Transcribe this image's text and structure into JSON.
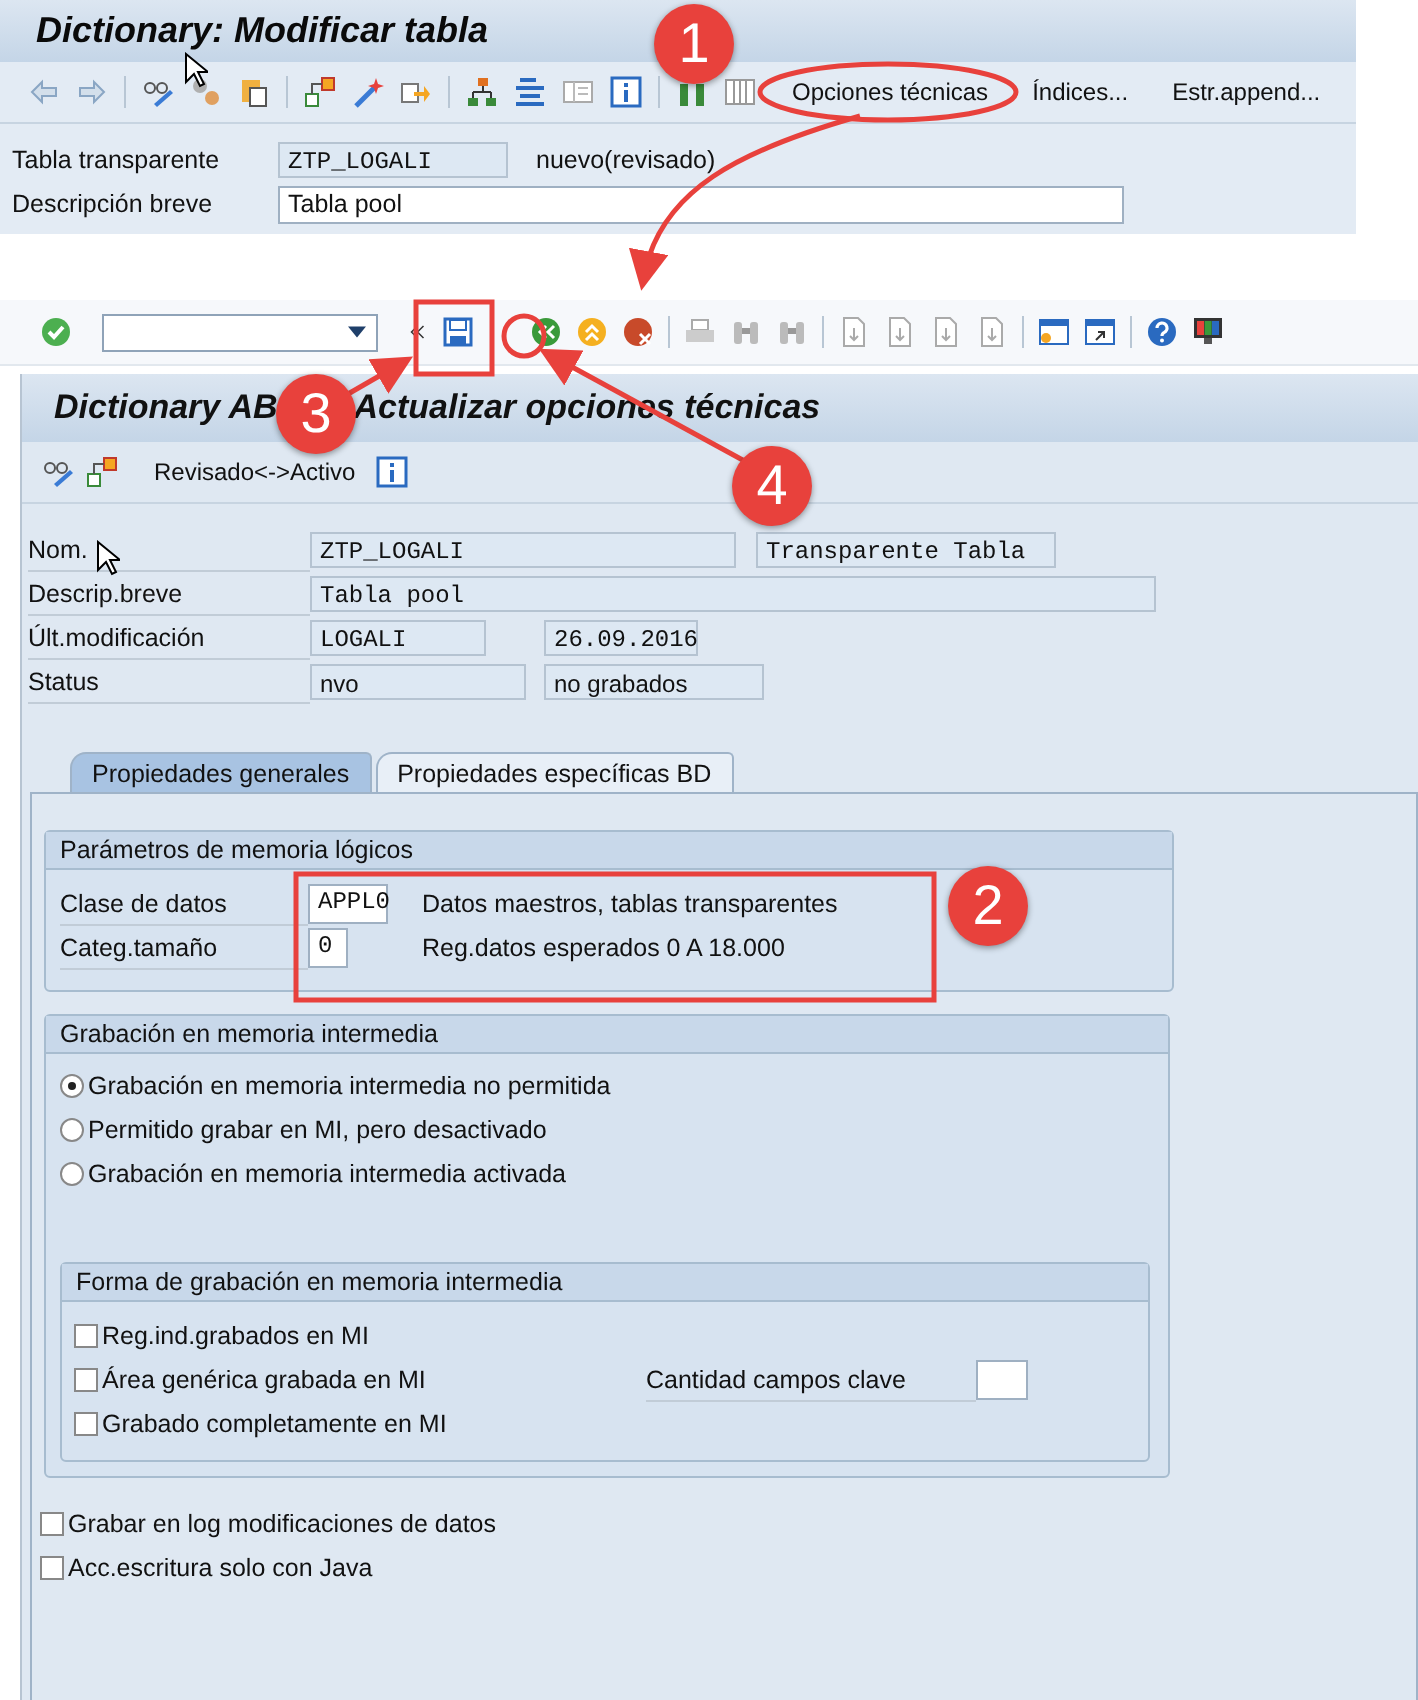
{
  "window": {
    "title": "Dictionary: Modificar tabla"
  },
  "toolbar": {
    "buttons": [
      {
        "label": "Opciones técnicas"
      },
      {
        "label": "Índices..."
      },
      {
        "label": "Estr.append..."
      }
    ]
  },
  "header_fields": [
    {
      "label": "Tabla transparente",
      "value": "ZTP_LOGALI",
      "note": "nuevo(revisado)"
    },
    {
      "label": "Descripción breve",
      "value": "Tabla pool"
    }
  ],
  "dialog": {
    "title_start": "Dictionary AB",
    "title_end": "Actualizar opciones técnicas",
    "toolbar_button": "Revisado<->Activo",
    "fields": [
      {
        "label": "Nom.",
        "values": [
          "ZTP_LOGALI",
          "Transparente Tabla"
        ]
      },
      {
        "label": "Descrip.breve",
        "values": [
          "Tabla pool"
        ]
      },
      {
        "label": "Últ.modificación",
        "values": [
          "LOGALI",
          "26.09.2016"
        ]
      },
      {
        "label": "Status",
        "values": [
          "nvo",
          "no grabados"
        ]
      }
    ],
    "tabs": [
      {
        "label": "Propiedades generales",
        "selected": true
      },
      {
        "label": "Propiedades específicas BD",
        "selected": false
      }
    ],
    "logical_params": {
      "title": "Parámetros de memoria lógicos",
      "rows": [
        {
          "label": "Clase de datos",
          "value": "APPL0",
          "description": "Datos maestros, tablas transparentes"
        },
        {
          "label": "Categ.tamaño",
          "value": "0",
          "description": "Reg.datos esperados 0 A 18.000"
        }
      ]
    },
    "buffering": {
      "title": "Grabación en memoria intermedia",
      "options": [
        {
          "label": "Grabación en memoria intermedia no permitida",
          "selected": true
        },
        {
          "label": "Permitido grabar en MI, pero desactivado",
          "selected": false
        },
        {
          "label": "Grabación en memoria intermedia activada",
          "selected": false
        }
      ],
      "type_group": {
        "title": "Forma de grabación en memoria intermedia",
        "options": [
          {
            "label": "Reg.ind.grabados en MI",
            "checked": false
          },
          {
            "label": "Área genérica grabada en MI",
            "checked": false
          },
          {
            "label": "Grabado completamente en MI",
            "checked": false
          }
        ],
        "key_fields_label": "Cantidad campos clave"
      }
    },
    "bottom_options": [
      {
        "label": "Grabar en log modificaciones de datos",
        "checked": false
      },
      {
        "label": "Acc.escritura solo con Java",
        "checked": false
      }
    ]
  },
  "annotations": [
    {
      "number": "1"
    },
    {
      "number": "2"
    },
    {
      "number": "3"
    },
    {
      "number": "4"
    }
  ]
}
